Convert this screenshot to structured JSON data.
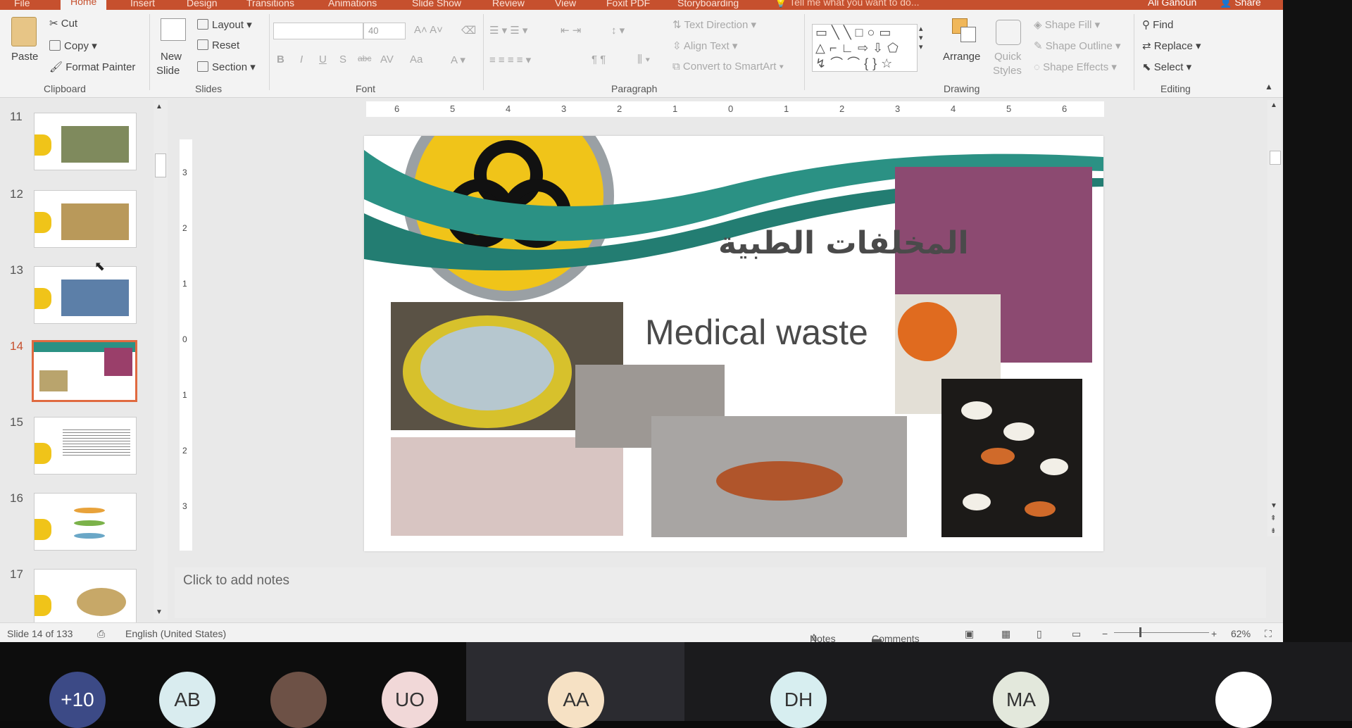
{
  "tabs": [
    "File",
    "Home",
    "Insert",
    "Design",
    "Transitions",
    "Animations",
    "Slide Show",
    "Review",
    "View",
    "Foxit PDF",
    "Storyboarding"
  ],
  "active_tab": "Home",
  "tell_me": "Tell me what you want to do...",
  "user_name": "Ali Ganoun",
  "share_label": "Share",
  "clipboard": {
    "paste": "Paste",
    "cut": "Cut",
    "copy": "Copy",
    "format_painter": "Format Painter",
    "group": "Clipboard"
  },
  "slides_group": {
    "new_slide_1": "New",
    "new_slide_2": "Slide",
    "layout": "Layout",
    "reset": "Reset",
    "section": "Section",
    "group": "Slides"
  },
  "font": {
    "size": "40",
    "group": "Font",
    "bold": "B",
    "italic": "I",
    "underline": "U",
    "shadow": "S",
    "strike": "abc",
    "spacing": "AV",
    "case": "Aa"
  },
  "paragraph": {
    "text_direction": "Text Direction",
    "align_text": "Align Text",
    "convert": "Convert to SmartArt",
    "group": "Paragraph"
  },
  "drawing": {
    "arrange": "Arrange",
    "quick_styles_1": "Quick",
    "quick_styles_2": "Styles",
    "shape_fill": "Shape Fill",
    "shape_outline": "Shape Outline",
    "shape_effects": "Shape Effects",
    "group": "Drawing"
  },
  "editing": {
    "find": "Find",
    "replace": "Replace",
    "select": "Select",
    "group": "Editing"
  },
  "thumbnails": [
    {
      "num": "11"
    },
    {
      "num": "12"
    },
    {
      "num": "13"
    },
    {
      "num": "14",
      "selected": true
    },
    {
      "num": "15"
    },
    {
      "num": "16"
    },
    {
      "num": "17"
    }
  ],
  "ruler_h_marks": [
    "6",
    "5",
    "4",
    "3",
    "2",
    "1",
    "0",
    "1",
    "2",
    "3",
    "4",
    "5",
    "6"
  ],
  "ruler_v_marks": [
    "3",
    "2",
    "1",
    "0",
    "1",
    "2",
    "3"
  ],
  "slide": {
    "title_arabic": "المخلفات الطبية",
    "title_english": "Medical waste"
  },
  "notes_placeholder": "Click to add notes",
  "status": {
    "slide_of": "Slide 14 of 133",
    "language": "English (United States)",
    "notes": "Notes",
    "comments": "Comments",
    "zoom": "62%"
  },
  "participants": [
    {
      "initials": "+10",
      "bg": "#3c4a86",
      "fg": "#ffffff"
    },
    {
      "initials": "AB",
      "bg": "#d9ecef",
      "fg": "#333333"
    },
    {
      "initials": "",
      "bg": "#6d5146",
      "fg": "#333333"
    },
    {
      "initials": "UO",
      "bg": "#f1d8d8",
      "fg": "#333333"
    },
    {
      "initials": "AA",
      "bg": "#f6e1c4",
      "fg": "#333333"
    },
    {
      "initials": "DH",
      "bg": "#d7eef0",
      "fg": "#333333"
    },
    {
      "initials": "MA",
      "bg": "#e3e8dc",
      "fg": "#333333"
    },
    {
      "initials": "",
      "bg": "#ffffff",
      "fg": "#333333"
    }
  ],
  "colors": {
    "accent": "#c6502e",
    "teal": "#2b9184",
    "hazard": "#f0c419"
  }
}
